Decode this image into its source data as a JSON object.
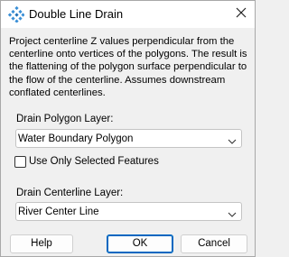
{
  "window": {
    "title": "Double Line Drain",
    "close_glyph": "✕"
  },
  "description": "Project centerline Z values perpendicular from the centerline onto vertices of the polygons. The result is the flattening of the polygon surface perpendicular to the flow of the centerline. Assumes downstream conflated centerlines.",
  "polygon_layer": {
    "label": "Drain Polygon Layer:",
    "value": "Water Boundary Polygon"
  },
  "selected_features": {
    "label": "Use Only Selected Features",
    "checked": false
  },
  "centerline_layer": {
    "label": "Drain Centerline Layer:",
    "value": "River Center Line"
  },
  "buttons": {
    "help": "Help",
    "ok": "OK",
    "cancel": "Cancel"
  },
  "colors": {
    "accent": "#0067c0",
    "icon": "#3a8fd6"
  }
}
